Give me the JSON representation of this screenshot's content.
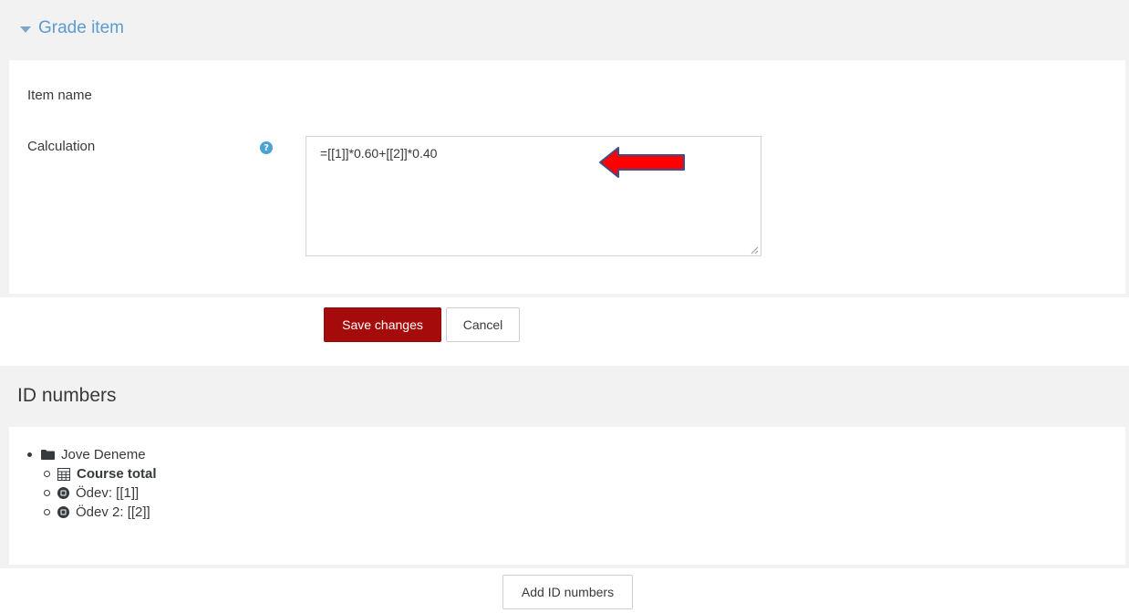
{
  "grade_item": {
    "legend": "Grade item",
    "item_name_label": "Item name",
    "calculation_label": "Calculation",
    "help_glyph": "?",
    "calculation_value": "=[[1]]*0.60+[[2]]*0.40"
  },
  "buttons": {
    "save": "Save changes",
    "cancel": "Cancel",
    "add_id_numbers": "Add ID numbers"
  },
  "id_numbers": {
    "title": "ID numbers",
    "tree": {
      "root": {
        "label": "Jove Deneme",
        "icon": "folder-icon"
      },
      "children": [
        {
          "label": "Course total",
          "icon": "calculator-icon",
          "bold": true
        },
        {
          "label": "Ödev: [[1]]",
          "icon": "assignment-icon"
        },
        {
          "label": "Ödev 2: [[2]]",
          "icon": "assignment-icon"
        }
      ]
    }
  },
  "colors": {
    "link_blue": "#5c9bd1",
    "primary_button": "#a60b0b",
    "section_background": "#f2f2f2",
    "arrow_red": "#ff0000"
  }
}
